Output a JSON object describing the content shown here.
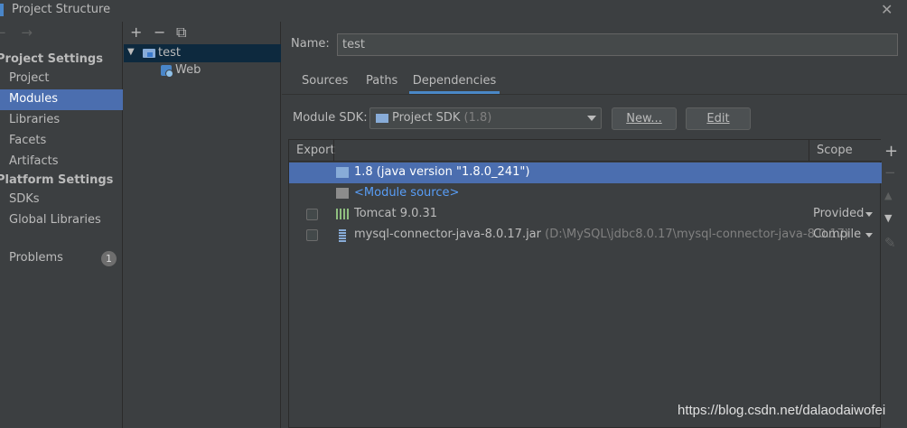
{
  "window": {
    "title": "Project Structure",
    "close_glyph": "✕"
  },
  "left_nav": {
    "arrows": "← →",
    "project_settings_head": "Project Settings",
    "platform_settings_head": "Platform Settings",
    "items": {
      "project": "Project",
      "modules": "Modules",
      "libraries": "Libraries",
      "facets": "Facets",
      "artifacts": "Artifacts",
      "sdks": "SDKs",
      "global_libraries": "Global Libraries",
      "problems": "Problems"
    },
    "selected": "Modules",
    "problems_count": "1"
  },
  "module_tree": {
    "toolbar": {
      "add": "+",
      "remove": "−",
      "copy": "⧉"
    },
    "root": {
      "label": "test",
      "expanded": true
    },
    "children": [
      {
        "label": "Web"
      }
    ]
  },
  "module_editor": {
    "name_label": "Name:",
    "name_value": "test",
    "tabs": [
      "Sources",
      "Paths",
      "Dependencies"
    ],
    "active_tab": "Dependencies",
    "sdk_label": "Module SDK:",
    "sdk_value": "Project SDK",
    "sdk_version": "(1.8)",
    "new_button": "New...",
    "edit_button": "Edit"
  },
  "dependencies": {
    "columns": {
      "export": "Export",
      "scope": "Scope"
    },
    "rows": [
      {
        "name": "1.8 (java version \"1.8.0_241\")",
        "selected": true
      },
      {
        "name": "<Module source>",
        "link": true
      },
      {
        "name": "Tomcat 9.0.31",
        "scope": "Provided",
        "checkbox": true
      },
      {
        "name": "mysql-connector-java-8.0.17.jar",
        "path": "(D:\\MySQL\\jdbc8.0.17\\mysql-connector-java-8.0.17)",
        "scope": "Compile",
        "checkbox": true
      }
    ],
    "side_tools": {
      "add": "+",
      "remove": "−",
      "up": "▲",
      "down": "▼",
      "edit": "✎"
    }
  },
  "watermark": "https://blog.csdn.net/dalaodaiwofei",
  "colors": {
    "background": "#3c3f41",
    "selection": "#4b6eaf",
    "tree_selection": "#0d293e",
    "link": "#589df6",
    "tab_underline": "#4a88c7"
  }
}
